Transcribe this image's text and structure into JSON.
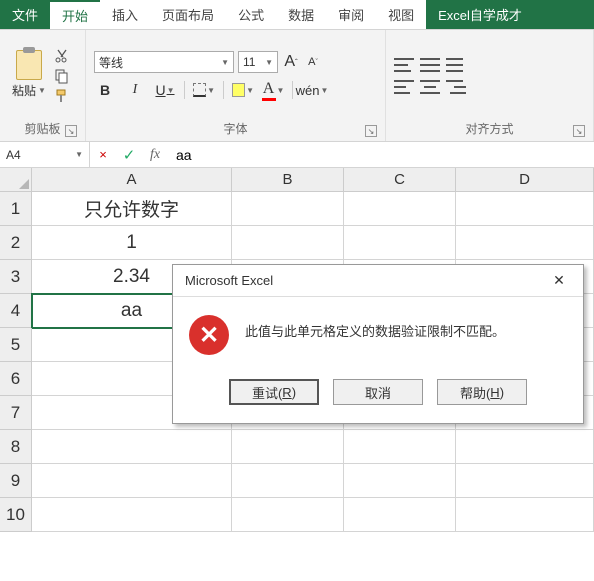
{
  "tabs": {
    "file": "文件",
    "home": "开始",
    "insert": "插入",
    "layout": "页面布局",
    "formula": "公式",
    "data": "数据",
    "review": "审阅",
    "view": "视图",
    "addin": "Excel自学成才"
  },
  "ribbon": {
    "clipboard": {
      "paste": "粘贴",
      "label": "剪贴板"
    },
    "font": {
      "name": "等线",
      "size": "11",
      "label": "字体",
      "bold": "B",
      "italic": "I",
      "underline": "U",
      "bigA": "A",
      "smallA": "A",
      "colorA": "A",
      "wen": "wén"
    },
    "align": {
      "label": "对齐方式"
    }
  },
  "namebox": "A4",
  "formula_cancel": "×",
  "formula_accept": "✓",
  "fx": "fx",
  "formula_value": "aa",
  "columns": [
    "A",
    "B",
    "C",
    "D"
  ],
  "rows": [
    "1",
    "2",
    "3",
    "4",
    "5",
    "6",
    "7",
    "8",
    "9",
    "10"
  ],
  "cells": {
    "A1": "只允许数字",
    "A2": "1",
    "A3": "2.34",
    "A4": "aa"
  },
  "dialog": {
    "title": "Microsoft Excel",
    "icon": "✕",
    "message": "此值与此单元格定义的数据验证限制不匹配。",
    "retry_pre": "重试(",
    "retry_key": "R",
    "retry_post": ")",
    "cancel": "取消",
    "help_pre": "帮助(",
    "help_key": "H",
    "help_post": ")"
  }
}
